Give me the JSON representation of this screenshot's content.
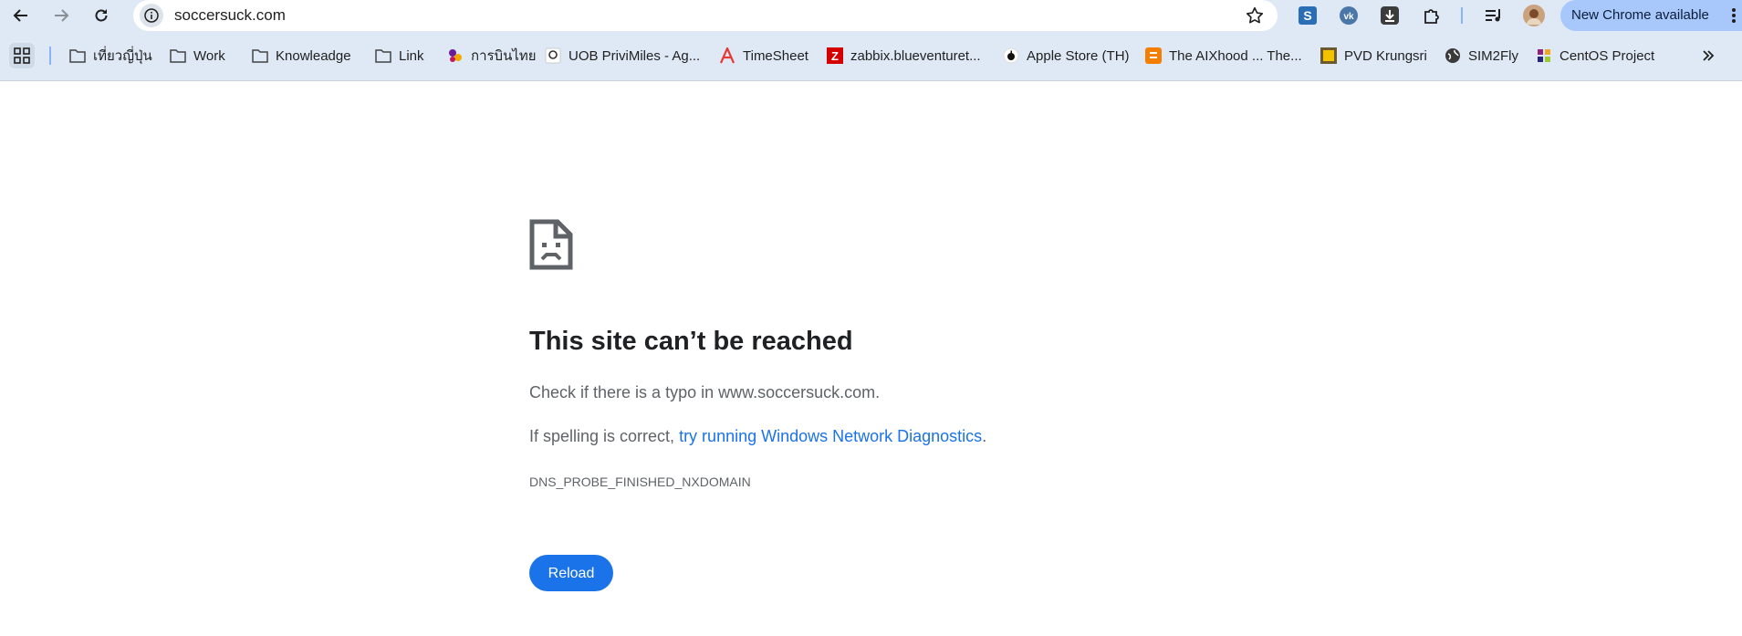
{
  "toolbar": {
    "url": "soccersuck.com",
    "new_chrome_label": "New Chrome available"
  },
  "bookmarks": [
    {
      "label": "เที่ยวญี่ปุ่น",
      "icon": "folder-icon"
    },
    {
      "label": "Work",
      "icon": "folder-icon"
    },
    {
      "label": "Knowleadge",
      "icon": "folder-icon"
    },
    {
      "label": "Link",
      "icon": "folder-icon"
    },
    {
      "label": "การบินไทย",
      "icon": "thai-airways-icon"
    },
    {
      "label": "UOB PriviMiles - Ag...",
      "icon": "uob-icon"
    },
    {
      "label": "TimeSheet",
      "icon": "timesheet-icon"
    },
    {
      "label": "zabbix.blueventuret...",
      "icon": "zabbix-icon"
    },
    {
      "label": "Apple Store (TH)",
      "icon": "apple-icon"
    },
    {
      "label": "The AIXhood ... The...",
      "icon": "blogger-icon"
    },
    {
      "label": "PVD Krungsri",
      "icon": "krungsri-icon"
    },
    {
      "label": "SIM2Fly",
      "icon": "globe-icon"
    },
    {
      "label": "CentOS Project",
      "icon": "centos-icon"
    }
  ],
  "error": {
    "title": "This site can’t be reached",
    "line1": "Check if there is a typo in www.soccersuck.com.",
    "line2_prefix": "If spelling is correct, ",
    "line2_link": "try running Windows Network Diagnostics",
    "line2_suffix": ".",
    "code": "DNS_PROBE_FINISHED_NXDOMAIN",
    "reload_label": "Reload"
  },
  "colors": {
    "toolbar_bg": "#dfe9f6",
    "accent": "#1a73e8",
    "new_chrome_bg": "#a8c7fa"
  }
}
